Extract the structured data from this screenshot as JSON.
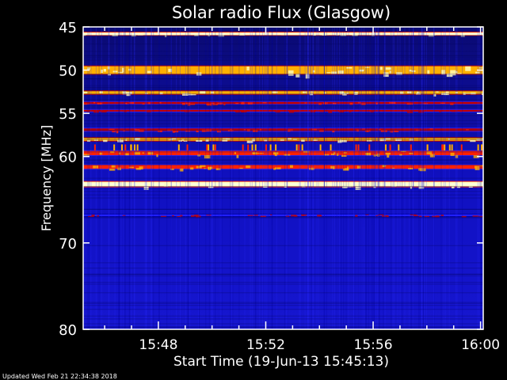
{
  "chart_data": {
    "type": "heatmap",
    "title": "Solar radio Flux (Glasgow)",
    "ylabel": "Frequency [MHz]",
    "xlabel": "Start Time (19-Jun-13 15:45:13)",
    "footer": "Updated Wed Feb 21 22:34:38 2018",
    "ylim": [
      45,
      80
    ],
    "y_reversed": true,
    "xlim_minutes": [
      45.2,
      60.1
    ],
    "yticks": [
      {
        "value": 45,
        "label": "45"
      },
      {
        "value": 50,
        "label": "50"
      },
      {
        "value": 55,
        "label": "55"
      },
      {
        "value": 60,
        "label": "60"
      },
      {
        "value": 70,
        "label": "70"
      },
      {
        "value": 80,
        "label": "80"
      }
    ],
    "xticks": [
      {
        "minute": 48,
        "label": "15:48"
      },
      {
        "minute": 52,
        "label": "15:52"
      },
      {
        "minute": 56,
        "label": "15:56"
      },
      {
        "minute": 60,
        "label": "16:00"
      }
    ],
    "bands": [
      {
        "freq": 45.8,
        "width": 0.3,
        "level": 0.98
      },
      {
        "freq": 50.0,
        "width": 0.9,
        "level": 0.78
      },
      {
        "freq": 52.6,
        "width": 0.35,
        "level": 0.86
      },
      {
        "freq": 53.8,
        "width": 0.25,
        "level": 0.45
      },
      {
        "freq": 54.7,
        "width": 0.2,
        "level": 0.42
      },
      {
        "freq": 56.9,
        "width": 0.3,
        "level": 0.45
      },
      {
        "freq": 58.0,
        "width": 0.35,
        "level": 0.9
      },
      {
        "freq": 59.6,
        "width": 0.5,
        "level": 0.62
      },
      {
        "freq": 61.2,
        "width": 0.45,
        "level": 0.66
      },
      {
        "freq": 63.2,
        "width": 0.55,
        "level": 0.98
      },
      {
        "freq": 66.8,
        "width": 0.2,
        "level": 0.38
      }
    ],
    "colormap": [
      "#000020",
      "#0000a0",
      "#2020ff",
      "#c00000",
      "#ff2000",
      "#ffb000",
      "#ffffc0"
    ]
  }
}
